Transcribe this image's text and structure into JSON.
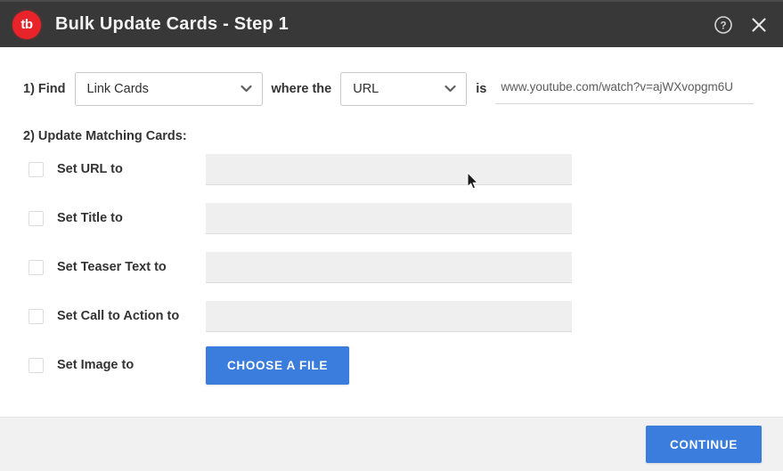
{
  "window": {
    "title": "Bulk Update Cards - Step 1",
    "logo_text": "tb",
    "help_icon": "help-circle-icon",
    "close_icon": "close-icon",
    "titlebar_color": "#383838",
    "accent_color": "#3b7ddd",
    "logo_color": "#e8242a"
  },
  "find_row": {
    "step_label": "1) Find",
    "card_type_select": {
      "value": "Link Cards",
      "options": [
        "Link Cards"
      ]
    },
    "where_label": "where the",
    "field_select": {
      "value": "URL",
      "options": [
        "URL"
      ]
    },
    "is_label": "is",
    "match_value": "www.youtube.com/watch?v=ajWXvopgm6U",
    "match_placeholder": ""
  },
  "update_section": {
    "heading": "2) Update Matching Cards:",
    "rows": [
      {
        "label": "Set URL to",
        "checked": false,
        "control": "text",
        "value": "",
        "placeholder": ""
      },
      {
        "label": "Set Title to",
        "checked": false,
        "control": "text",
        "value": "",
        "placeholder": ""
      },
      {
        "label": "Set Teaser Text to",
        "checked": false,
        "control": "text",
        "value": "",
        "placeholder": ""
      },
      {
        "label": "Set Call to Action to",
        "checked": false,
        "control": "text",
        "value": "",
        "placeholder": ""
      },
      {
        "label": "Set Image to",
        "checked": false,
        "control": "button",
        "button_label": "CHOOSE A FILE"
      }
    ]
  },
  "footer": {
    "continue_label": "CONTINUE"
  }
}
